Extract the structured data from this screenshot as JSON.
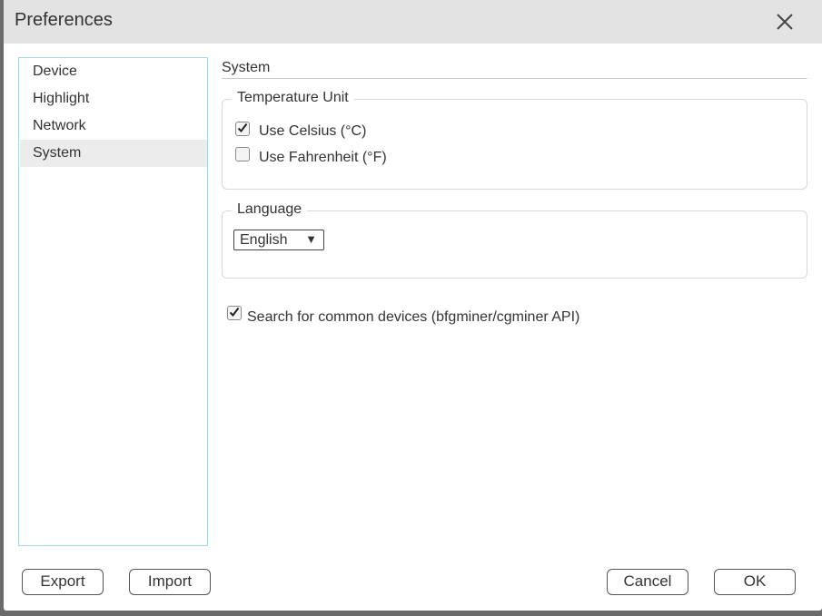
{
  "window": {
    "title": "Preferences",
    "close_icon": "close-icon"
  },
  "sidebar": {
    "items": [
      {
        "label": "Device",
        "selected": false
      },
      {
        "label": "Highlight",
        "selected": false
      },
      {
        "label": "Network",
        "selected": false
      },
      {
        "label": "System",
        "selected": true
      }
    ]
  },
  "main": {
    "section_title": "System",
    "temperature_group": {
      "legend": "Temperature Unit",
      "options": [
        {
          "label": "Use Celsius (°C)",
          "checked": true
        },
        {
          "label": "Use Fahrenheit (°F)",
          "checked": false
        }
      ]
    },
    "language_group": {
      "legend": "Language",
      "selected": "English",
      "arrow": "▼"
    },
    "search_devices": {
      "label": "Search for common devices (bfgminer/cgminer API)",
      "checked": true
    }
  },
  "buttons": {
    "export": "Export",
    "import": "Import",
    "cancel": "Cancel",
    "ok": "OK"
  },
  "colors": {
    "titlebar": "#e3e3e3",
    "sidebar_border": "#a8d8e0",
    "selected_item": "#ececec"
  }
}
